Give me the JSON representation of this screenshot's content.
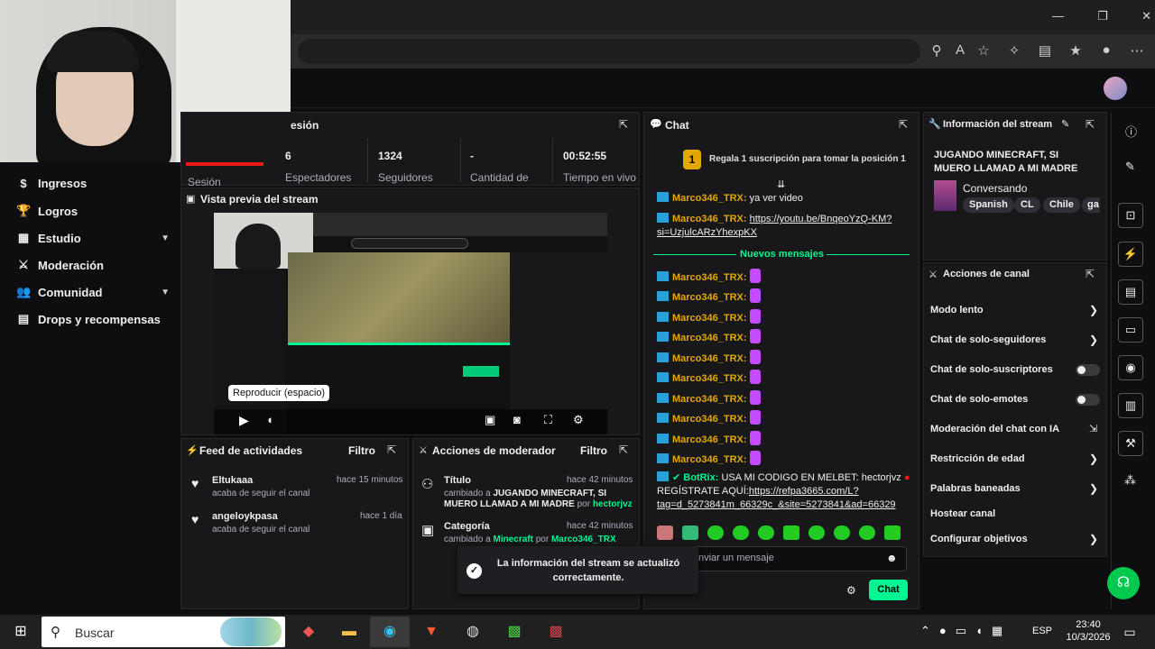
{
  "browser": {
    "window_controls": [
      "—",
      "❐",
      "✕"
    ]
  },
  "nav": {
    "items": [
      {
        "label": "Ingresos",
        "icon": "dollar-icon"
      },
      {
        "label": "Logros",
        "icon": "trophy-icon"
      },
      {
        "label": "Estudio",
        "icon": "media-icon"
      },
      {
        "label": "Moderación",
        "icon": "sword-icon"
      },
      {
        "label": "Comunidad",
        "icon": "people-icon"
      },
      {
        "label": "Drops y recompensas",
        "icon": "drops-icon"
      }
    ]
  },
  "session": {
    "title_fragment": "esión",
    "tab_label": "Sesión",
    "stats": [
      {
        "value": "6",
        "label": "Espectadores"
      },
      {
        "value": "1324",
        "label": "Seguidores"
      },
      {
        "value": "-",
        "label": "Cantidad de"
      },
      {
        "value": "00:52:55",
        "label": "Tiempo en vivo"
      }
    ]
  },
  "preview": {
    "title": "Vista previa del stream",
    "tooltip": "Reproducir (espacio)"
  },
  "activity": {
    "title": "Feed de actividades",
    "filter": "Filtro",
    "items": [
      {
        "user": "Eltukaaa",
        "action": "acaba de seguir el canal",
        "time": "hace 15 minutos"
      },
      {
        "user": "angeloykpasa",
        "action": "acaba de seguir el canal",
        "time": "hace 1 día"
      }
    ]
  },
  "mod_actions": {
    "title": "Acciones de moderador",
    "filter": "Filtro",
    "items": [
      {
        "title": "Título",
        "time": "hace 42 minutos",
        "prefix": "cambiado a",
        "value": "JUGANDO MINECRAFT, SI MUERO LLAMAD A MI MADRE",
        "by": "por",
        "user": "hectorjvz"
      },
      {
        "title": "Categoría",
        "time": "hace 42 minutos",
        "prefix": "cambiado a",
        "value": "Minecraft",
        "by": "por",
        "user": "Marco346_TRX"
      }
    ]
  },
  "toast": {
    "text": "La información del stream se actualizó correctamente."
  },
  "chat": {
    "title": "Chat",
    "gift_rank": "1",
    "gift_text": "Regala 1 suscripción para tomar la posición 1",
    "messages": [
      {
        "user": "Marco346_TRX",
        "text": "ya ver video"
      },
      {
        "user": "Marco346_TRX",
        "link": "https://youtu.be/BnqeoYzQ-KM?si=UzjulcARzYhexpKX"
      }
    ],
    "new_messages": "Nuevos mensajes",
    "repeat_user": "Marco346_TRX",
    "bot": {
      "user": "BotRix",
      "text": "USA MI CODIGO EN MELBET: hectorjvz",
      "text2": "REGÍSTRATE AQUÍ:",
      "link": "https://refpa3665.com/L?tag=d_5273841m_66329c_&site=5273841&ad=66329"
    },
    "input_placeholder": "nviar un mensaje",
    "send": "Chat"
  },
  "stream_info": {
    "title": "Información del stream",
    "stream_title": "JUGANDO MINECRAFT, SI MUERO LLAMAD A MI MADRE",
    "category": "Conversando",
    "tags": [
      "Spanish",
      "CL",
      "Chile",
      "ga"
    ]
  },
  "channel_actions": {
    "title": "Acciones de canal",
    "items": [
      {
        "label": "Modo lento",
        "control": "chevron"
      },
      {
        "label": "Chat de solo-seguidores",
        "control": "chevron"
      },
      {
        "label": "Chat de solo-suscriptores",
        "control": "toggle"
      },
      {
        "label": "Chat de solo-emotes",
        "control": "toggle"
      },
      {
        "label": "Moderación del chat con IA",
        "control": "external"
      },
      {
        "label": "Restricción de edad",
        "control": "chevron"
      },
      {
        "label": "Palabras baneadas",
        "control": "chevron"
      },
      {
        "label": "Hostear canal",
        "control": "none"
      },
      {
        "label": "Configurar objetivos",
        "control": "chevron"
      }
    ]
  },
  "taskbar": {
    "search": "Buscar",
    "lang": "ESP",
    "time": "23:40",
    "date": "10/3/2026"
  },
  "colors": {
    "accent_green": "#00f593",
    "username_gold": "#e2a800",
    "panel_bg": "#18181b",
    "page_bg": "#0e0e10"
  }
}
